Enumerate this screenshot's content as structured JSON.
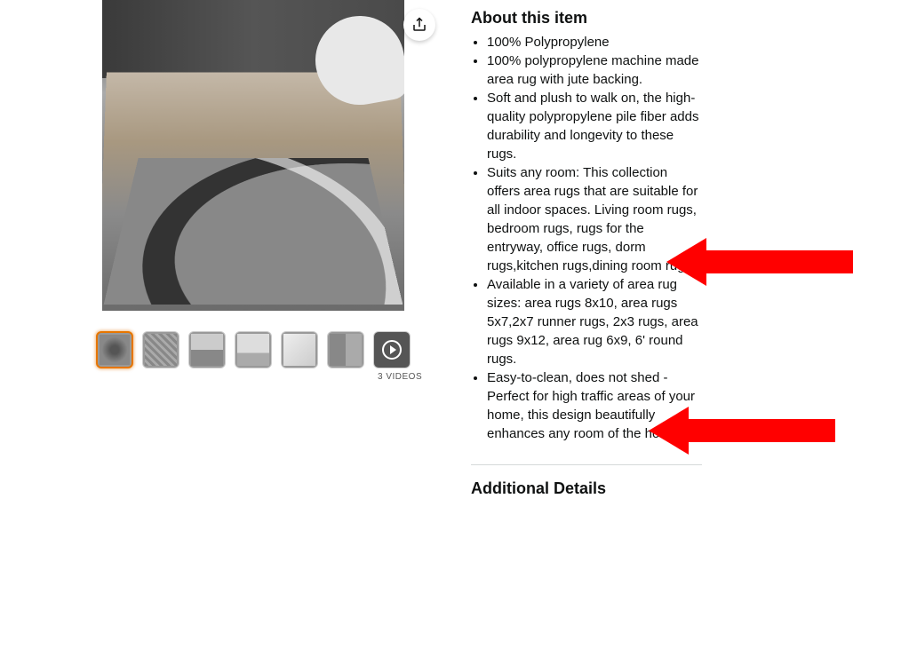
{
  "about": {
    "title": "About this item",
    "bullets": [
      "100% Polypropylene",
      "100% polypropylene machine made area rug with jute backing.",
      "Soft and plush to walk on, the high-quality polypropylene pile fiber adds durability and longevity to these rugs.",
      "Suits any room: This collection offers area rugs that are suitable for all indoor spaces. Living room rugs, bedroom rugs, rugs for the entryway, office rugs, dorm rugs,kitchen rugs,dining room rugs.",
      "Available in a variety of area rug sizes: area rugs 8x10, area rugs 5x7,2x7 runner rugs, 2x3 rugs, area rugs 9x12, area rug 6x9, 6' round rugs.",
      "Easy-to-clean, does not shed - Perfect for high traffic areas of your home, this design beautifully enhances any room of the home."
    ]
  },
  "additional": {
    "title": "Additional Details"
  },
  "gallery": {
    "videos_label": "3 VIDEOS"
  },
  "icons": {
    "share": "share-icon",
    "play": "play-icon"
  }
}
